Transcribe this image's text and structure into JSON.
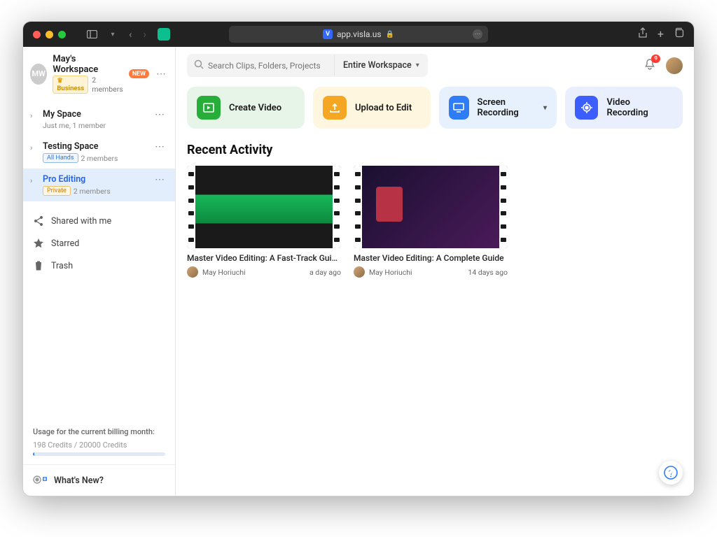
{
  "browser": {
    "url": "app.visla.us"
  },
  "workspace": {
    "initials": "MW",
    "name": "May's Workspace",
    "plan": "Business",
    "members": "2 members",
    "new_badge": "NEW"
  },
  "spaces": [
    {
      "name": "My Space",
      "subtitle": "Just me, 1 member",
      "tag": null,
      "active": false
    },
    {
      "name": "Testing Space",
      "subtitle": "2 members",
      "tag": "All Hands",
      "tag_class": "allhands",
      "active": false
    },
    {
      "name": "Pro Editing",
      "subtitle": "2 members",
      "tag": "Private",
      "tag_class": "private",
      "active": true
    }
  ],
  "nav": {
    "shared": "Shared with me",
    "starred": "Starred",
    "trash": "Trash"
  },
  "usage": {
    "label": "Usage for the current billing month:",
    "text": "198 Credits / 20000 Credits"
  },
  "whats_new": "What's New?",
  "search": {
    "placeholder": "Search Clips, Folders, Projects",
    "scope": "Entire Workspace"
  },
  "notifications": {
    "count": "9"
  },
  "actions": {
    "create": "Create Video",
    "upload": "Upload to Edit",
    "screen": "Screen Recording",
    "video": "Video Recording"
  },
  "section_title": "Recent Activity",
  "recent": [
    {
      "title": "Master Video Editing: A Fast-Track Guide f...",
      "author": "May Horiuchi",
      "time": "a day ago"
    },
    {
      "title": "Master Video Editing: A Complete Guide",
      "author": "May Horiuchi",
      "time": "14 days ago"
    }
  ]
}
